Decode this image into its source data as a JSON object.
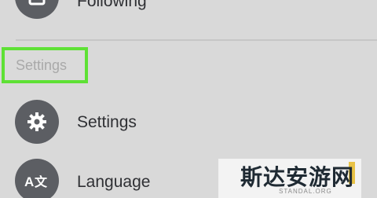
{
  "menu": {
    "top_item": {
      "label": "Following",
      "icon": "square-icon"
    },
    "section_header": "Settings",
    "items": [
      {
        "label": "Settings",
        "icon": "gear-icon"
      },
      {
        "label": "Language",
        "icon": "translate-icon"
      }
    ]
  },
  "colors": {
    "background": "#d9d9d9",
    "icon_circle": "#5c5e63",
    "highlight_border": "#5ee135",
    "label_text": "#2f3034",
    "section_text": "#a9a9a9"
  },
  "watermark": {
    "text": "斯达安游网",
    "subtext": "STANDAL.ORG"
  }
}
